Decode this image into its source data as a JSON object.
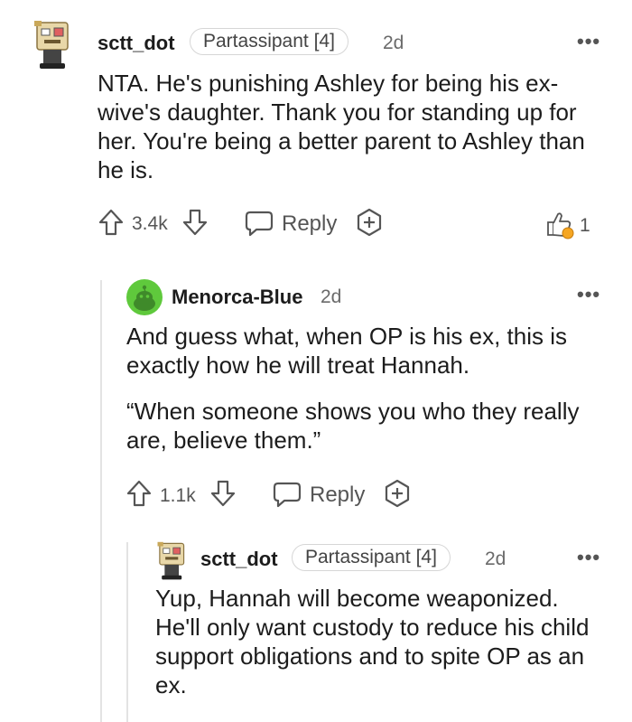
{
  "comments": [
    {
      "author": "sctt_dot",
      "flair": "Partassipant [4]",
      "time": "2d",
      "more": "•••",
      "body": "NTA. He's punishing Ashley for being his ex-wive's daughter. Thank you for standing up for her. You're being a better parent to Ashley than he is.",
      "score": "3.4k",
      "reply_label": "Reply",
      "award_count": "1"
    },
    {
      "author": "Menorca-Blue",
      "time": "2d",
      "more": "•••",
      "body_p1": "And guess what, when OP is his ex, this is exactly how he will treat Hannah.",
      "body_p2": "“When someone shows you who they really are, believe them.”",
      "score": "1.1k",
      "reply_label": "Reply"
    },
    {
      "author": "sctt_dot",
      "flair": "Partassipant [4]",
      "time": "2d",
      "more": "•••",
      "body": "Yup, Hannah will become weaponized. He'll only want custody to reduce his child support obligations and to spite OP as an ex."
    }
  ],
  "colors": {
    "accent_green": "#5fc93c",
    "thread_line": "#e3e3e3",
    "text_meta": "#6a6a6a"
  },
  "icons": [
    "upvote-icon",
    "downvote-icon",
    "reply-icon",
    "award-add-icon",
    "award-icon",
    "more-icon"
  ]
}
